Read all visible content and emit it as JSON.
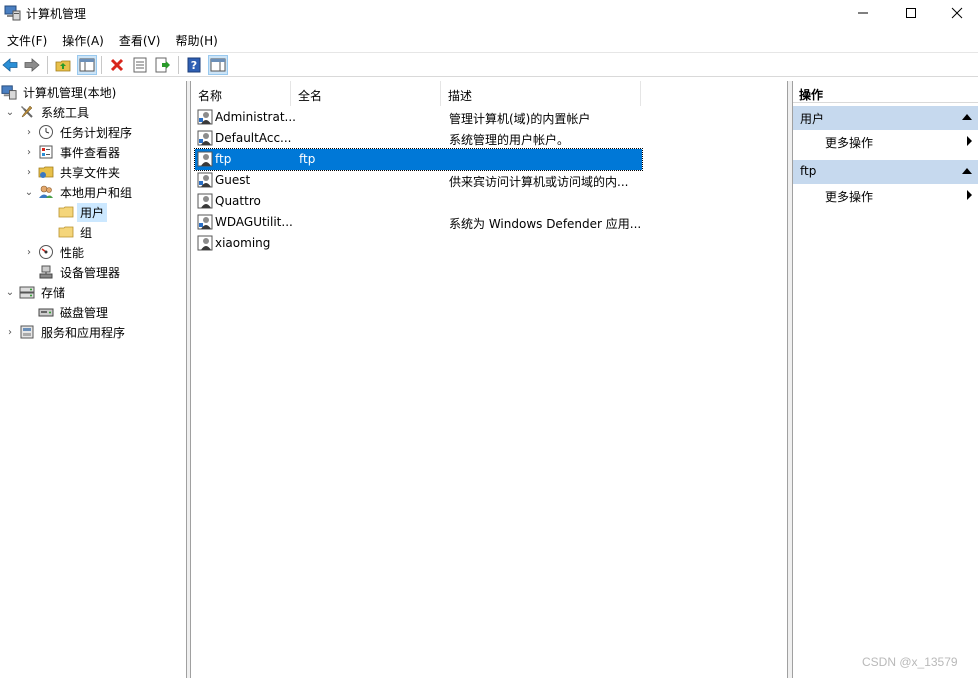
{
  "window": {
    "title": "计算机管理"
  },
  "menu": [
    "文件(F)",
    "操作(A)",
    "查看(V)",
    "帮助(H)"
  ],
  "toolbar": {
    "buttons": [
      "back-icon",
      "forward-icon",
      "up-folder-icon",
      "show-hide-tree-icon",
      "delete-icon",
      "properties-icon",
      "export-list-icon",
      "help-icon",
      "show-hide-action-pane-icon"
    ]
  },
  "tree": {
    "root": "计算机管理(本地)",
    "system_tools": "系统工具",
    "task_scheduler": "任务计划程序",
    "event_viewer": "事件查看器",
    "shared_folders": "共享文件夹",
    "local_users_groups": "本地用户和组",
    "users": "用户",
    "groups": "组",
    "performance": "性能",
    "device_manager": "设备管理器",
    "storage": "存储",
    "disk_management": "磁盘管理",
    "services_apps": "服务和应用程序"
  },
  "list": {
    "columns": {
      "name": "名称",
      "fullname": "全名",
      "description": "描述"
    },
    "rows": [
      {
        "name": "Administrat...",
        "fullname": "",
        "description": "管理计算机(域)的内置帐户"
      },
      {
        "name": "DefaultAcc...",
        "fullname": "",
        "description": "系统管理的用户帐户。"
      },
      {
        "name": "ftp",
        "fullname": "ftp",
        "description": ""
      },
      {
        "name": "Guest",
        "fullname": "",
        "description": "供来宾访问计算机或访问域的内..."
      },
      {
        "name": "Quattro",
        "fullname": "",
        "description": ""
      },
      {
        "name": "WDAGUtilit...",
        "fullname": "",
        "description": "系统为 Windows Defender 应用..."
      },
      {
        "name": "xiaoming",
        "fullname": "",
        "description": ""
      }
    ],
    "selected_index": 2
  },
  "actions": {
    "title": "操作",
    "section1": "用户",
    "section1_more": "更多操作",
    "section2": "ftp",
    "section2_more": "更多操作"
  },
  "watermark": "CSDN @x_13579",
  "colors": {
    "selection": "#0078d7",
    "section": "#c6d9ee",
    "tree_selection": "#cce8ff"
  }
}
